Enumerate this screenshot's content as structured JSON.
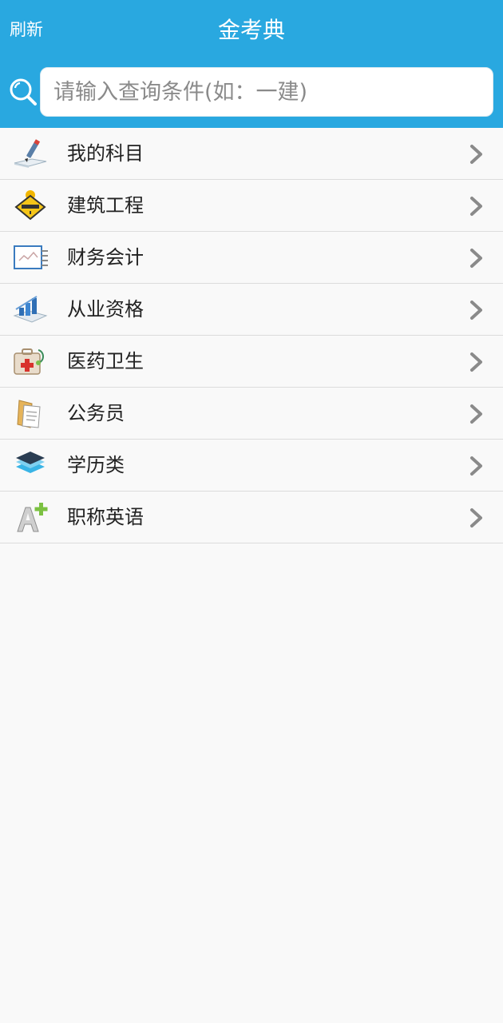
{
  "header": {
    "refresh_label": "刷新",
    "title": "金考典",
    "bg_color": "#29a8e0"
  },
  "search": {
    "placeholder": "请输入查询条件(如：一建)",
    "value": ""
  },
  "categories": [
    {
      "label": "我的科目",
      "icon": "pencil-book-icon"
    },
    {
      "label": "建筑工程",
      "icon": "construction-sign-icon"
    },
    {
      "label": "财务会计",
      "icon": "ledger-chart-icon"
    },
    {
      "label": "从业资格",
      "icon": "bar-chart-book-icon"
    },
    {
      "label": "医药卫生",
      "icon": "medical-kit-icon"
    },
    {
      "label": "公务员",
      "icon": "document-folder-icon"
    },
    {
      "label": "学历类",
      "icon": "layers-icon"
    },
    {
      "label": "职称英语",
      "icon": "letter-a-plus-icon"
    }
  ]
}
